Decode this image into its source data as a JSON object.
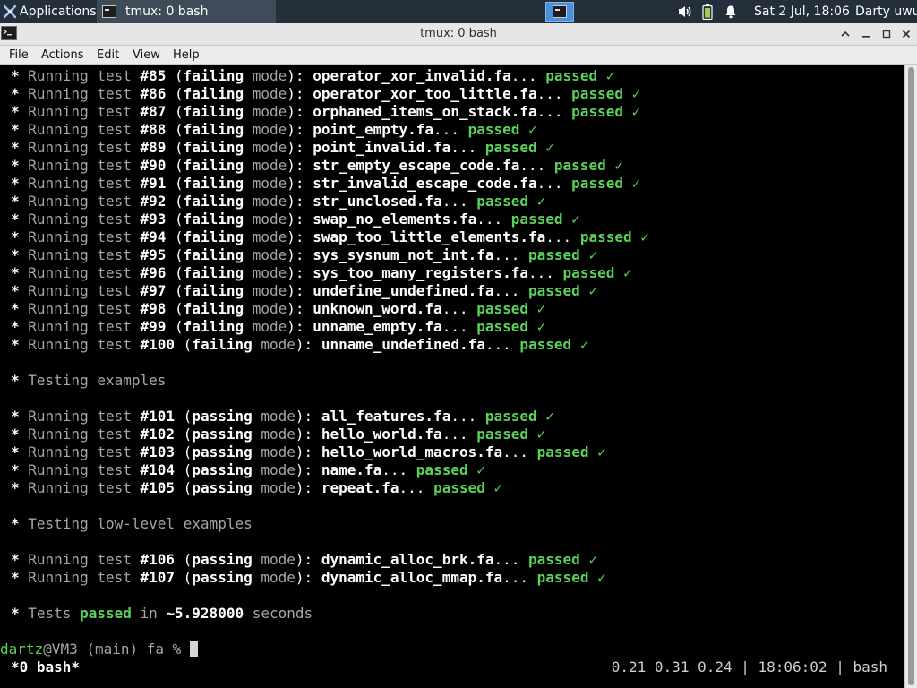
{
  "panel": {
    "applications_label": "Applications",
    "task_label": "tmux: 0 bash",
    "clock": "Sat  2 Jul, 18:06",
    "user": "Darty uwu",
    "icons": [
      "xfce-mouse-icon",
      "terminal-icon",
      "volume-icon",
      "battery-icon",
      "notification-bell-icon"
    ]
  },
  "window": {
    "title": "tmux: 0 bash",
    "buttons": [
      "keep-above",
      "minimize",
      "maximize",
      "close"
    ]
  },
  "menubar": {
    "file": "File",
    "actions": "Actions",
    "edit": "Edit",
    "view": "View",
    "help": "Help"
  },
  "colors": {
    "passed": "#5ad25a",
    "user": "#5ad25a",
    "dim": "#a6a6a6",
    "panel_bg": "#232f3a",
    "workspace": "#4a8fd8"
  },
  "terminal": {
    "lines": [
      {
        "type": "test",
        "num": "#85",
        "mode": "failing",
        "file": "operator_xor_invalid.fa"
      },
      {
        "type": "test",
        "num": "#86",
        "mode": "failing",
        "file": "operator_xor_too_little.fa"
      },
      {
        "type": "test",
        "num": "#87",
        "mode": "failing",
        "file": "orphaned_items_on_stack.fa"
      },
      {
        "type": "test",
        "num": "#88",
        "mode": "failing",
        "file": "point_empty.fa"
      },
      {
        "type": "test",
        "num": "#89",
        "mode": "failing",
        "file": "point_invalid.fa"
      },
      {
        "type": "test",
        "num": "#90",
        "mode": "failing",
        "file": "str_empty_escape_code.fa"
      },
      {
        "type": "test",
        "num": "#91",
        "mode": "failing",
        "file": "str_invalid_escape_code.fa"
      },
      {
        "type": "test",
        "num": "#92",
        "mode": "failing",
        "file": "str_unclosed.fa"
      },
      {
        "type": "test",
        "num": "#93",
        "mode": "failing",
        "file": "swap_no_elements.fa"
      },
      {
        "type": "test",
        "num": "#94",
        "mode": "failing",
        "file": "swap_too_little_elements.fa"
      },
      {
        "type": "test",
        "num": "#95",
        "mode": "failing",
        "file": "sys_sysnum_not_int.fa"
      },
      {
        "type": "test",
        "num": "#96",
        "mode": "failing",
        "file": "sys_too_many_registers.fa"
      },
      {
        "type": "test",
        "num": "#97",
        "mode": "failing",
        "file": "undefine_undefined.fa"
      },
      {
        "type": "test",
        "num": "#98",
        "mode": "failing",
        "file": "unknown_word.fa"
      },
      {
        "type": "test",
        "num": "#99",
        "mode": "failing",
        "file": "unname_empty.fa"
      },
      {
        "type": "test",
        "num": "#100",
        "mode": "failing",
        "file": "unname_undefined.fa"
      },
      {
        "type": "blank"
      },
      {
        "type": "section",
        "text": "Testing examples"
      },
      {
        "type": "blank"
      },
      {
        "type": "test",
        "num": "#101",
        "mode": "passing",
        "file": "all_features.fa"
      },
      {
        "type": "test",
        "num": "#102",
        "mode": "passing",
        "file": "hello_world.fa"
      },
      {
        "type": "test",
        "num": "#103",
        "mode": "passing",
        "file": "hello_world_macros.fa"
      },
      {
        "type": "test",
        "num": "#104",
        "mode": "passing",
        "file": "name.fa"
      },
      {
        "type": "test",
        "num": "#105",
        "mode": "passing",
        "file": "repeat.fa"
      },
      {
        "type": "blank"
      },
      {
        "type": "section",
        "text": "Testing low-level examples"
      },
      {
        "type": "blank"
      },
      {
        "type": "test",
        "num": "#106",
        "mode": "passing",
        "file": "dynamic_alloc_brk.fa"
      },
      {
        "type": "test",
        "num": "#107",
        "mode": "passing",
        "file": "dynamic_alloc_mmap.fa"
      },
      {
        "type": "blank"
      },
      {
        "type": "summary",
        "pre": "Tests",
        "status": "passed",
        "mid": "in",
        "time": "~5.928000",
        "post": "seconds"
      },
      {
        "type": "blank"
      }
    ],
    "labels": {
      "bullet": "*",
      "running": "Running test",
      "mode_word": "mode",
      "passed": "passed",
      "check": "✓"
    },
    "prompt": {
      "user": "dartz",
      "host_path": "@VM3 (main) fa %"
    },
    "status_bar": {
      "left": "*0 bash*",
      "right": "0.21 0.31 0.24 | 18:06:02 | bash"
    }
  }
}
